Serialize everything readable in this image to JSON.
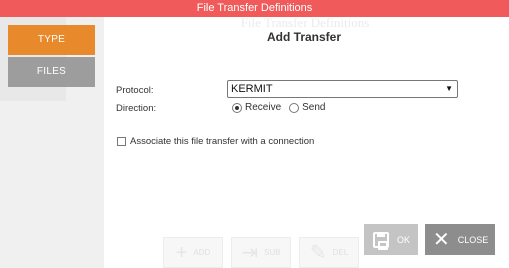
{
  "window": {
    "title": "File Transfer Definitions"
  },
  "background": {
    "ghost_title": "File Transfer Definitions",
    "toolbar": [
      {
        "label": "ADD"
      },
      {
        "label": "SUB"
      },
      {
        "label": "DEL"
      }
    ]
  },
  "tabs": [
    {
      "label": "TYPE",
      "active": true
    },
    {
      "label": "FILES",
      "active": false
    }
  ],
  "dialog": {
    "title": "Add Transfer",
    "protocol_label": "Protocol:",
    "protocol_value": "KERMIT",
    "direction_label": "Direction:",
    "direction_options": [
      {
        "label": "Receive",
        "checked": true
      },
      {
        "label": "Send",
        "checked": false
      }
    ],
    "associate_label": "Associate this file transfer with a connection",
    "associate_checked": false,
    "ok_label": "OK",
    "close_label": "CLOSE"
  },
  "colors": {
    "titlebar": "#f05a5a",
    "tab_active": "#e8892c",
    "tab_inactive": "#9d9d9d",
    "ok_button": "#c4c4c4",
    "close_button": "#8d8d8d"
  },
  "icons": {
    "ok": "save-icon",
    "close": "close-icon"
  }
}
